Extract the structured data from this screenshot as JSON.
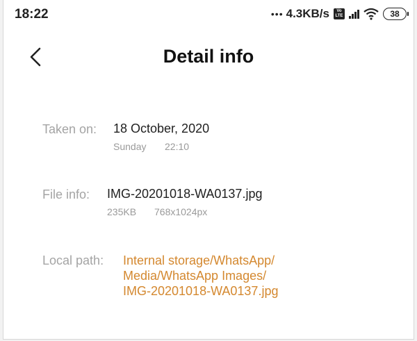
{
  "status_bar": {
    "time": "18:22",
    "dots": "•••",
    "net_speed": "4.3KB/s",
    "volte_top": "Vo",
    "volte_bottom": "LTE",
    "battery": "38"
  },
  "header": {
    "title": "Detail info"
  },
  "taken_on": {
    "label": "Taken on:",
    "date": "18 October, 2020",
    "day": "Sunday",
    "time": "22:10"
  },
  "file_info": {
    "label": "File info:",
    "name": "IMG-20201018-WA0137.jpg",
    "size": "235KB",
    "resolution": "768x1024px"
  },
  "local_path": {
    "label": "Local path:",
    "lines": [
      "Internal storage/WhatsApp/",
      "Media/WhatsApp Images/",
      "IMG-20201018-WA0137.jpg"
    ]
  },
  "colors": {
    "link": "#d4882f",
    "label": "#a4a4a4"
  },
  "icons": {
    "back": "chevron-left-icon",
    "wifi": "wifi-icon",
    "signal": "signal-icon",
    "battery": "battery-icon",
    "volte": "volte-icon"
  }
}
